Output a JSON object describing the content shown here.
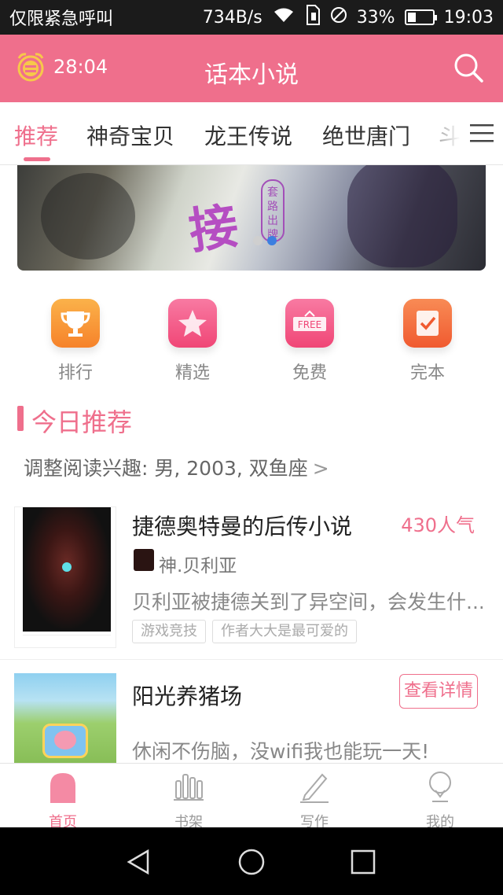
{
  "status_bar": {
    "carrier": "仅限紧急呼叫",
    "speed": "734B/s",
    "battery": "33%",
    "battery_level": 0.33,
    "time": "19:03"
  },
  "header": {
    "timer": "28:04",
    "title": "话本小说"
  },
  "tabs": [
    {
      "label": "推荐",
      "active": true
    },
    {
      "label": "神奇宝贝",
      "active": false
    },
    {
      "label": "龙王传说",
      "active": false
    },
    {
      "label": "绝世唐门",
      "active": false
    },
    {
      "label": "斗罗",
      "active": false
    }
  ],
  "banner": {
    "calligraphy": "接",
    "seal": "套路出牌",
    "page_count": 2,
    "active_index": 1
  },
  "categories": [
    {
      "label": "排行",
      "icon": "trophy-icon",
      "color": "#f9932c"
    },
    {
      "label": "精选",
      "icon": "star-icon",
      "color": "#f4507c"
    },
    {
      "label": "免费",
      "icon": "free-icon",
      "color": "#f4507c",
      "badge": "FREE"
    },
    {
      "label": "完本",
      "icon": "check-icon",
      "color": "#f3673b"
    }
  ],
  "section": {
    "title": "今日推荐",
    "interest": "调整阅读兴趣: 男, 2003, 双鱼座",
    "chevron": ">"
  },
  "books": [
    {
      "title": "捷德奥特曼的后传小说",
      "popularity": "430人气",
      "author": "神.贝利亚",
      "desc": "贝利亚被捷德关到了异空间，会发生什...",
      "tags": [
        "游戏竞技",
        "作者大大是最可爱的"
      ]
    }
  ],
  "promo": {
    "title": "阳光养猪场",
    "desc": "休闲不伤脑，没wifi我也能玩一天!",
    "button": "查看详情"
  },
  "bottom_nav": [
    {
      "label": "首页",
      "icon": "home-icon",
      "active": true
    },
    {
      "label": "书架",
      "icon": "bookshelf-icon",
      "active": false
    },
    {
      "label": "写作",
      "icon": "pen-icon",
      "active": false
    },
    {
      "label": "我的",
      "icon": "profile-icon",
      "active": false
    }
  ],
  "colors": {
    "accent": "#ef6f8c",
    "status_bar": "#1b1b1b"
  }
}
